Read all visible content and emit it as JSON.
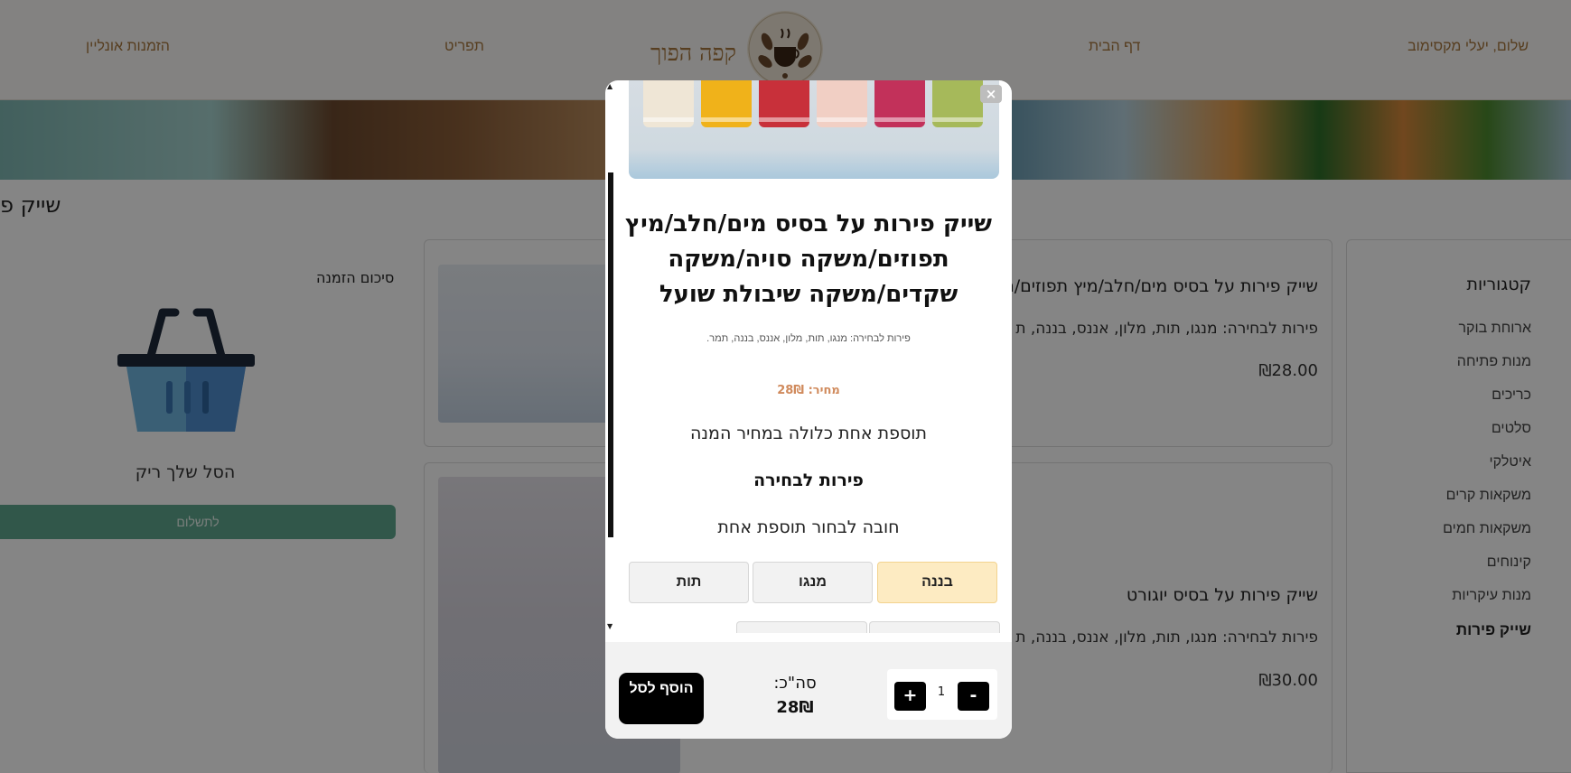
{
  "nav": {
    "greeting": "שלום, יעלי מקסימוב",
    "home": "דף הבית",
    "logo_text": "קפה הפוך",
    "menu": "תפריט",
    "online_orders": "הזמנות אונליין"
  },
  "section_title": "שייק פ",
  "order_summary": {
    "title": "סיכום הזמנה",
    "empty_text": "הסל שלך ריק",
    "pay_button": "לתשלום"
  },
  "products": [
    {
      "title": "שייק פירות על בסיס מים/חלב/מיץ תפוזים/מש",
      "desc": "פירות לבחירה: מנגו, תות, מלון, אננס, בננה, ת",
      "price": "₪28.00"
    },
    {
      "title": "שייק פירות על בסיס יוגורט",
      "desc": "פירות לבחירה: מנגו, תות, מלון, אננס, בננה, ת",
      "price": "₪30.00"
    }
  ],
  "categories": {
    "title": "קטגוריות",
    "items": [
      "ארוחת בוקר",
      "מנות פתיחה",
      "כריכים",
      "סלטים",
      "איטלקי",
      "משקאות קרים",
      "משקאות חמים",
      "קינוחים",
      "מנות עיקריות",
      "שייק פירות"
    ],
    "active_index": 9
  },
  "modal": {
    "close": "×",
    "title": "שייק פירות על בסיס מים/חלב/מיץ תפוזים/משקה סויה/משקה שקדים/משקה שיבולת שועל",
    "subtitle": "פירות לבחירה: מנגו, תות, מלון, אננס, בננה, תמר.",
    "price": "מחיר: 28₪",
    "included_note": "תוספת אחת כלולה במחיר המנה",
    "choice_group": "פירות לבחירה",
    "must_choose": "חובה לבחור תוספת אחת",
    "options": [
      "בננה",
      "מנגו",
      "תות"
    ],
    "selected_option": "בננה",
    "quantity": "1",
    "plus": "+",
    "minus": "-",
    "total_label": "סה\"כ:",
    "total_value": "28₪",
    "add_button": "הוסף לסל"
  },
  "colors": {
    "brand_gold": "#a8773e",
    "pay_green": "#5fa88e",
    "selected_option": "#fdebc2",
    "price_orange": "#d08a5c"
  }
}
